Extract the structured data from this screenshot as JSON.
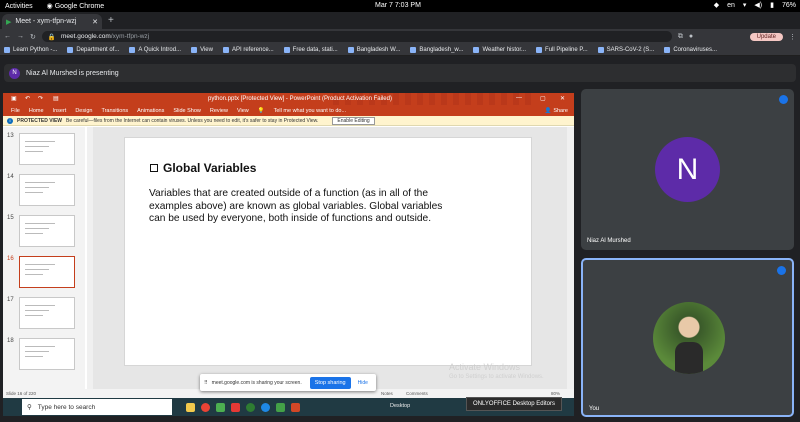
{
  "gnome": {
    "activities": "Activities",
    "app": "Google Chrome",
    "clock": "Mar 7  7:03 PM",
    "lang": "en",
    "battery": "76%"
  },
  "chrome": {
    "tab_title": "Meet - xym-tfpn-wzj",
    "url_host": "meet.google.com",
    "url_path": "/xym-tfpn-wzj",
    "update": "Update",
    "bookmarks": [
      "Learn Python -...",
      "Department of...",
      "A Quick Introd...",
      "View",
      "API reference...",
      "Free data, stati...",
      "Bangladesh W...",
      "Bangladesh_w...",
      "Weather histor...",
      "Full Pipeline P...",
      "SARS-CoV-2 (S...",
      "Coronaviruses..."
    ]
  },
  "meet": {
    "presenting": "Niaz Al Murshed is presenting",
    "avatar_letter": "N",
    "tile1_name": "Niaz Al Murshed",
    "tile2_name": "You"
  },
  "ppt": {
    "title": "python.pptx [Protected View] - PowerPoint (Product Activation Failed)",
    "menu": [
      "File",
      "Home",
      "Insert",
      "Design",
      "Transitions",
      "Animations",
      "Slide Show",
      "Review",
      "View"
    ],
    "tellme": "Tell me what you want to do...",
    "share": "Share",
    "protected_label": "PROTECTED VIEW",
    "protected_msg": "Be careful—files from the Internet can contain viruses. Unless you need to edit, it's safer to stay in Protected View.",
    "enable": "Enable Editing",
    "thumb_numbers": [
      "13",
      "14",
      "15",
      "16",
      "17",
      "18"
    ],
    "slide_heading": "Global Variables",
    "slide_body": "Variables that are created outside of a function (as in all of the examples above) are known as global variables. Global variables can be used by everyone, both inside of functions and outside.",
    "status_slide": "Slide 16 of 220",
    "status_notes": "Notes",
    "status_comments": "Comments",
    "status_zoom": "80%"
  },
  "sharing": {
    "msg": "meet.google.com is sharing your screen.",
    "stop": "Stop sharing",
    "hide": "Hide"
  },
  "activate": {
    "line1": "Activate Windows",
    "line2": "Go to Settings to activate Windows."
  },
  "taskbar": {
    "search": "Type here to search",
    "desktop": "Desktop",
    "onlyoffice": "ONLYOFFICE Desktop Editors"
  }
}
